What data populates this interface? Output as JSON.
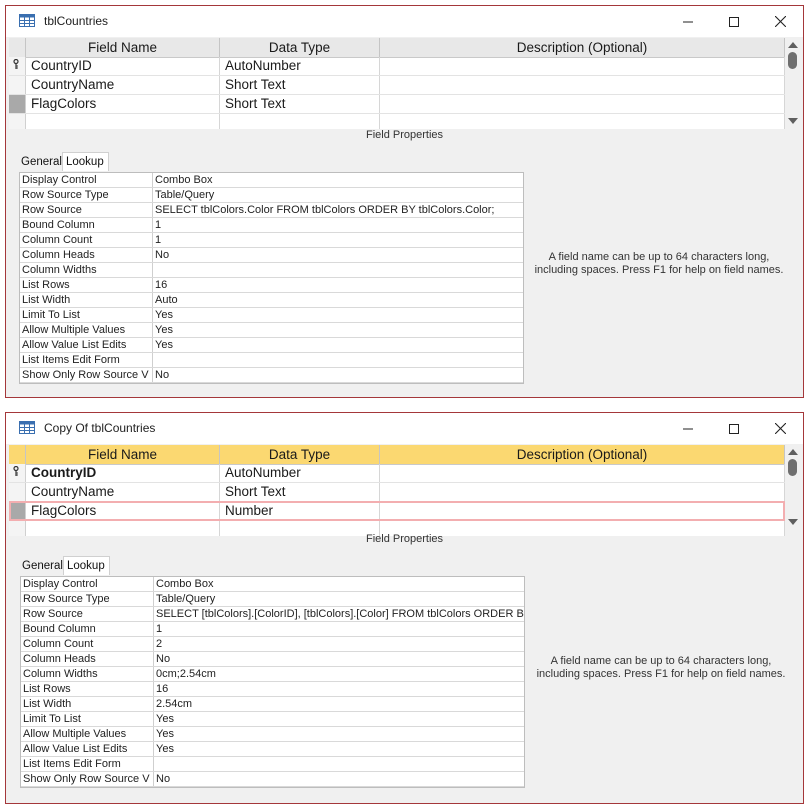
{
  "windows": [
    {
      "title": "tblCountries",
      "grid": {
        "headers": [
          "Field Name",
          "Data Type",
          "Description (Optional)"
        ],
        "rows": [
          {
            "field": "CountryID",
            "type": "AutoNumber",
            "desc": ""
          },
          {
            "field": "CountryName",
            "type": "Short Text",
            "desc": ""
          },
          {
            "field": "FlagColors",
            "type": "Short Text",
            "desc": ""
          }
        ]
      },
      "field_properties_label": "Field Properties",
      "tabs": [
        "General",
        "Lookup"
      ],
      "properties": [
        {
          "name": "Display Control",
          "value": "Combo Box"
        },
        {
          "name": "Row Source Type",
          "value": "Table/Query"
        },
        {
          "name": "Row Source",
          "value": "SELECT tblColors.Color FROM tblColors ORDER BY tblColors.Color;"
        },
        {
          "name": "Bound Column",
          "value": "1"
        },
        {
          "name": "Column Count",
          "value": "1"
        },
        {
          "name": "Column Heads",
          "value": "No"
        },
        {
          "name": "Column Widths",
          "value": ""
        },
        {
          "name": "List Rows",
          "value": "16"
        },
        {
          "name": "List Width",
          "value": "Auto"
        },
        {
          "name": "Limit To List",
          "value": "Yes"
        },
        {
          "name": "Allow Multiple Values",
          "value": "Yes"
        },
        {
          "name": "Allow Value List Edits",
          "value": "Yes"
        },
        {
          "name": "List Items Edit Form",
          "value": ""
        },
        {
          "name": "Show Only Row Source V",
          "value": "No"
        }
      ],
      "hint": "A field name can be up to 64 characters long, including spaces. Press F1 for help on field names."
    },
    {
      "title": "Copy Of tblCountries",
      "grid": {
        "headers": [
          "Field Name",
          "Data Type",
          "Description (Optional)"
        ],
        "rows": [
          {
            "field": "CountryID",
            "type": "AutoNumber",
            "desc": ""
          },
          {
            "field": "CountryName",
            "type": "Short Text",
            "desc": ""
          },
          {
            "field": "FlagColors",
            "type": "Number",
            "desc": ""
          }
        ]
      },
      "field_properties_label": "Field Properties",
      "tabs": [
        "General",
        "Lookup"
      ],
      "properties": [
        {
          "name": "Display Control",
          "value": "Combo Box"
        },
        {
          "name": "Row Source Type",
          "value": "Table/Query"
        },
        {
          "name": "Row Source",
          "value": "SELECT [tblColors].[ColorID], [tblColors].[Color] FROM tblColors ORDER B"
        },
        {
          "name": "Bound Column",
          "value": "1"
        },
        {
          "name": "Column Count",
          "value": "2"
        },
        {
          "name": "Column Heads",
          "value": "No"
        },
        {
          "name": "Column Widths",
          "value": "0cm;2.54cm"
        },
        {
          "name": "List Rows",
          "value": "16"
        },
        {
          "name": "List Width",
          "value": "2.54cm"
        },
        {
          "name": "Limit To List",
          "value": "Yes"
        },
        {
          "name": "Allow Multiple Values",
          "value": "Yes"
        },
        {
          "name": "Allow Value List Edits",
          "value": "Yes"
        },
        {
          "name": "List Items Edit Form",
          "value": ""
        },
        {
          "name": "Show Only Row Source V",
          "value": "No"
        }
      ],
      "hint": "A field name can be up to 64 characters long, including spaces. Press F1 for help on field names."
    }
  ],
  "colors": {
    "window_border": "#a4373a",
    "header_active": "#fbd871",
    "row_highlight": "#f3aeb0"
  },
  "icons": {
    "title": "table-icon",
    "min": "minimize-icon",
    "max": "maximize-icon",
    "close": "close-icon",
    "key": "primary-key-icon"
  }
}
